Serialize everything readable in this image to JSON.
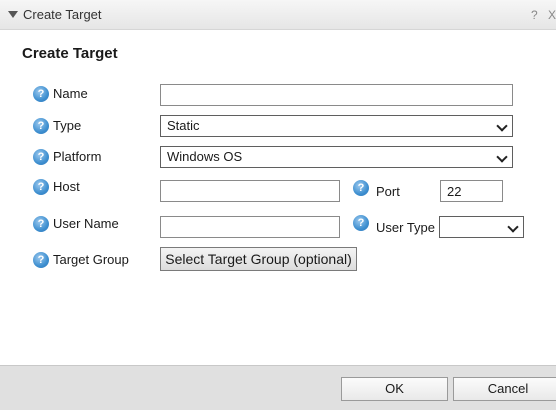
{
  "window": {
    "title": "Create Target",
    "help_glyph": "?",
    "close_glyph": "X"
  },
  "form": {
    "heading": "Create Target",
    "help_icon_glyph": "?",
    "fields": {
      "name": {
        "label": "Name",
        "value": ""
      },
      "type": {
        "label": "Type",
        "value": "Static"
      },
      "platform": {
        "label": "Platform",
        "value": "Windows OS"
      },
      "host": {
        "label": "Host",
        "value": ""
      },
      "port": {
        "label": "Port",
        "value": "22"
      },
      "user_name": {
        "label": "User Name",
        "value": ""
      },
      "user_type": {
        "label": "User Type",
        "value": ""
      },
      "target_group": {
        "label": "Target Group",
        "button_label": "Select Target Group (optional)"
      }
    }
  },
  "footer": {
    "ok_label": "OK",
    "cancel_label": "Cancel"
  },
  "colors": {
    "help_icon": "#3e8fd0",
    "footer_bg": "#e0e0e0",
    "titlebar_bg": "#eeeeee"
  },
  "icons": [
    "collapse-triangle-icon",
    "help-icon",
    "close-icon"
  ]
}
